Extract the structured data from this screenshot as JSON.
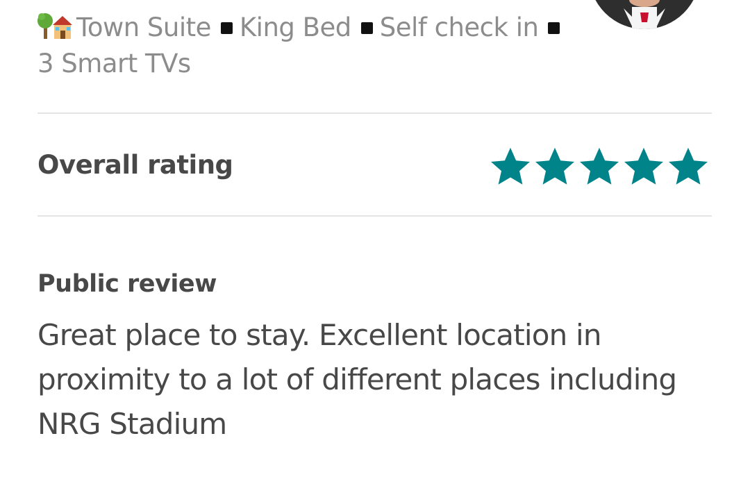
{
  "listing": {
    "segments": [
      "Town Suite",
      "King Bed",
      "Self check in",
      "3 Smart TVs"
    ],
    "icons": {
      "lead": "house-with-garden-icon",
      "separator": "black-square-icon"
    }
  },
  "host": {
    "avatar": "host-avatar"
  },
  "rating": {
    "label": "Overall rating",
    "stars": 5,
    "max": 5,
    "star_color": "#00848a"
  },
  "review": {
    "label": "Public review",
    "text": "Great place to stay. Excellent location in proximity to a lot of different places including NRG Stadium"
  },
  "colors": {
    "heading": "#484848",
    "muted": "#8c8c8c",
    "divider": "#e4e4e4",
    "accent": "#00848a"
  }
}
